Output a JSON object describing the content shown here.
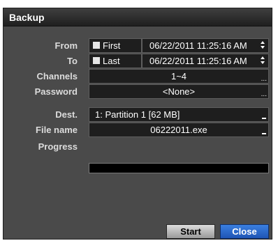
{
  "dialog": {
    "title": "Backup"
  },
  "labels": {
    "from": "From",
    "to": "To",
    "channels": "Channels",
    "password": "Password",
    "dest": "Dest.",
    "file_name": "File name",
    "progress": "Progress"
  },
  "from": {
    "checkbox_label": "First",
    "datetime": "06/22/2011  11:25:16 AM"
  },
  "to": {
    "checkbox_label": "Last",
    "datetime": "06/22/2011  11:25:16 AM"
  },
  "channels": {
    "value": "1~4"
  },
  "password": {
    "value": "<None>"
  },
  "dest": {
    "value": "1: Partition 1 [62 MB]"
  },
  "file_name": {
    "value": "06222011.exe"
  },
  "progress": {
    "value": 0
  },
  "buttons": {
    "start": "Start",
    "close": "Close"
  },
  "colors": {
    "window": "#4a4a4a",
    "field": "#1e1e1e",
    "close_button": "#1f55b5"
  }
}
